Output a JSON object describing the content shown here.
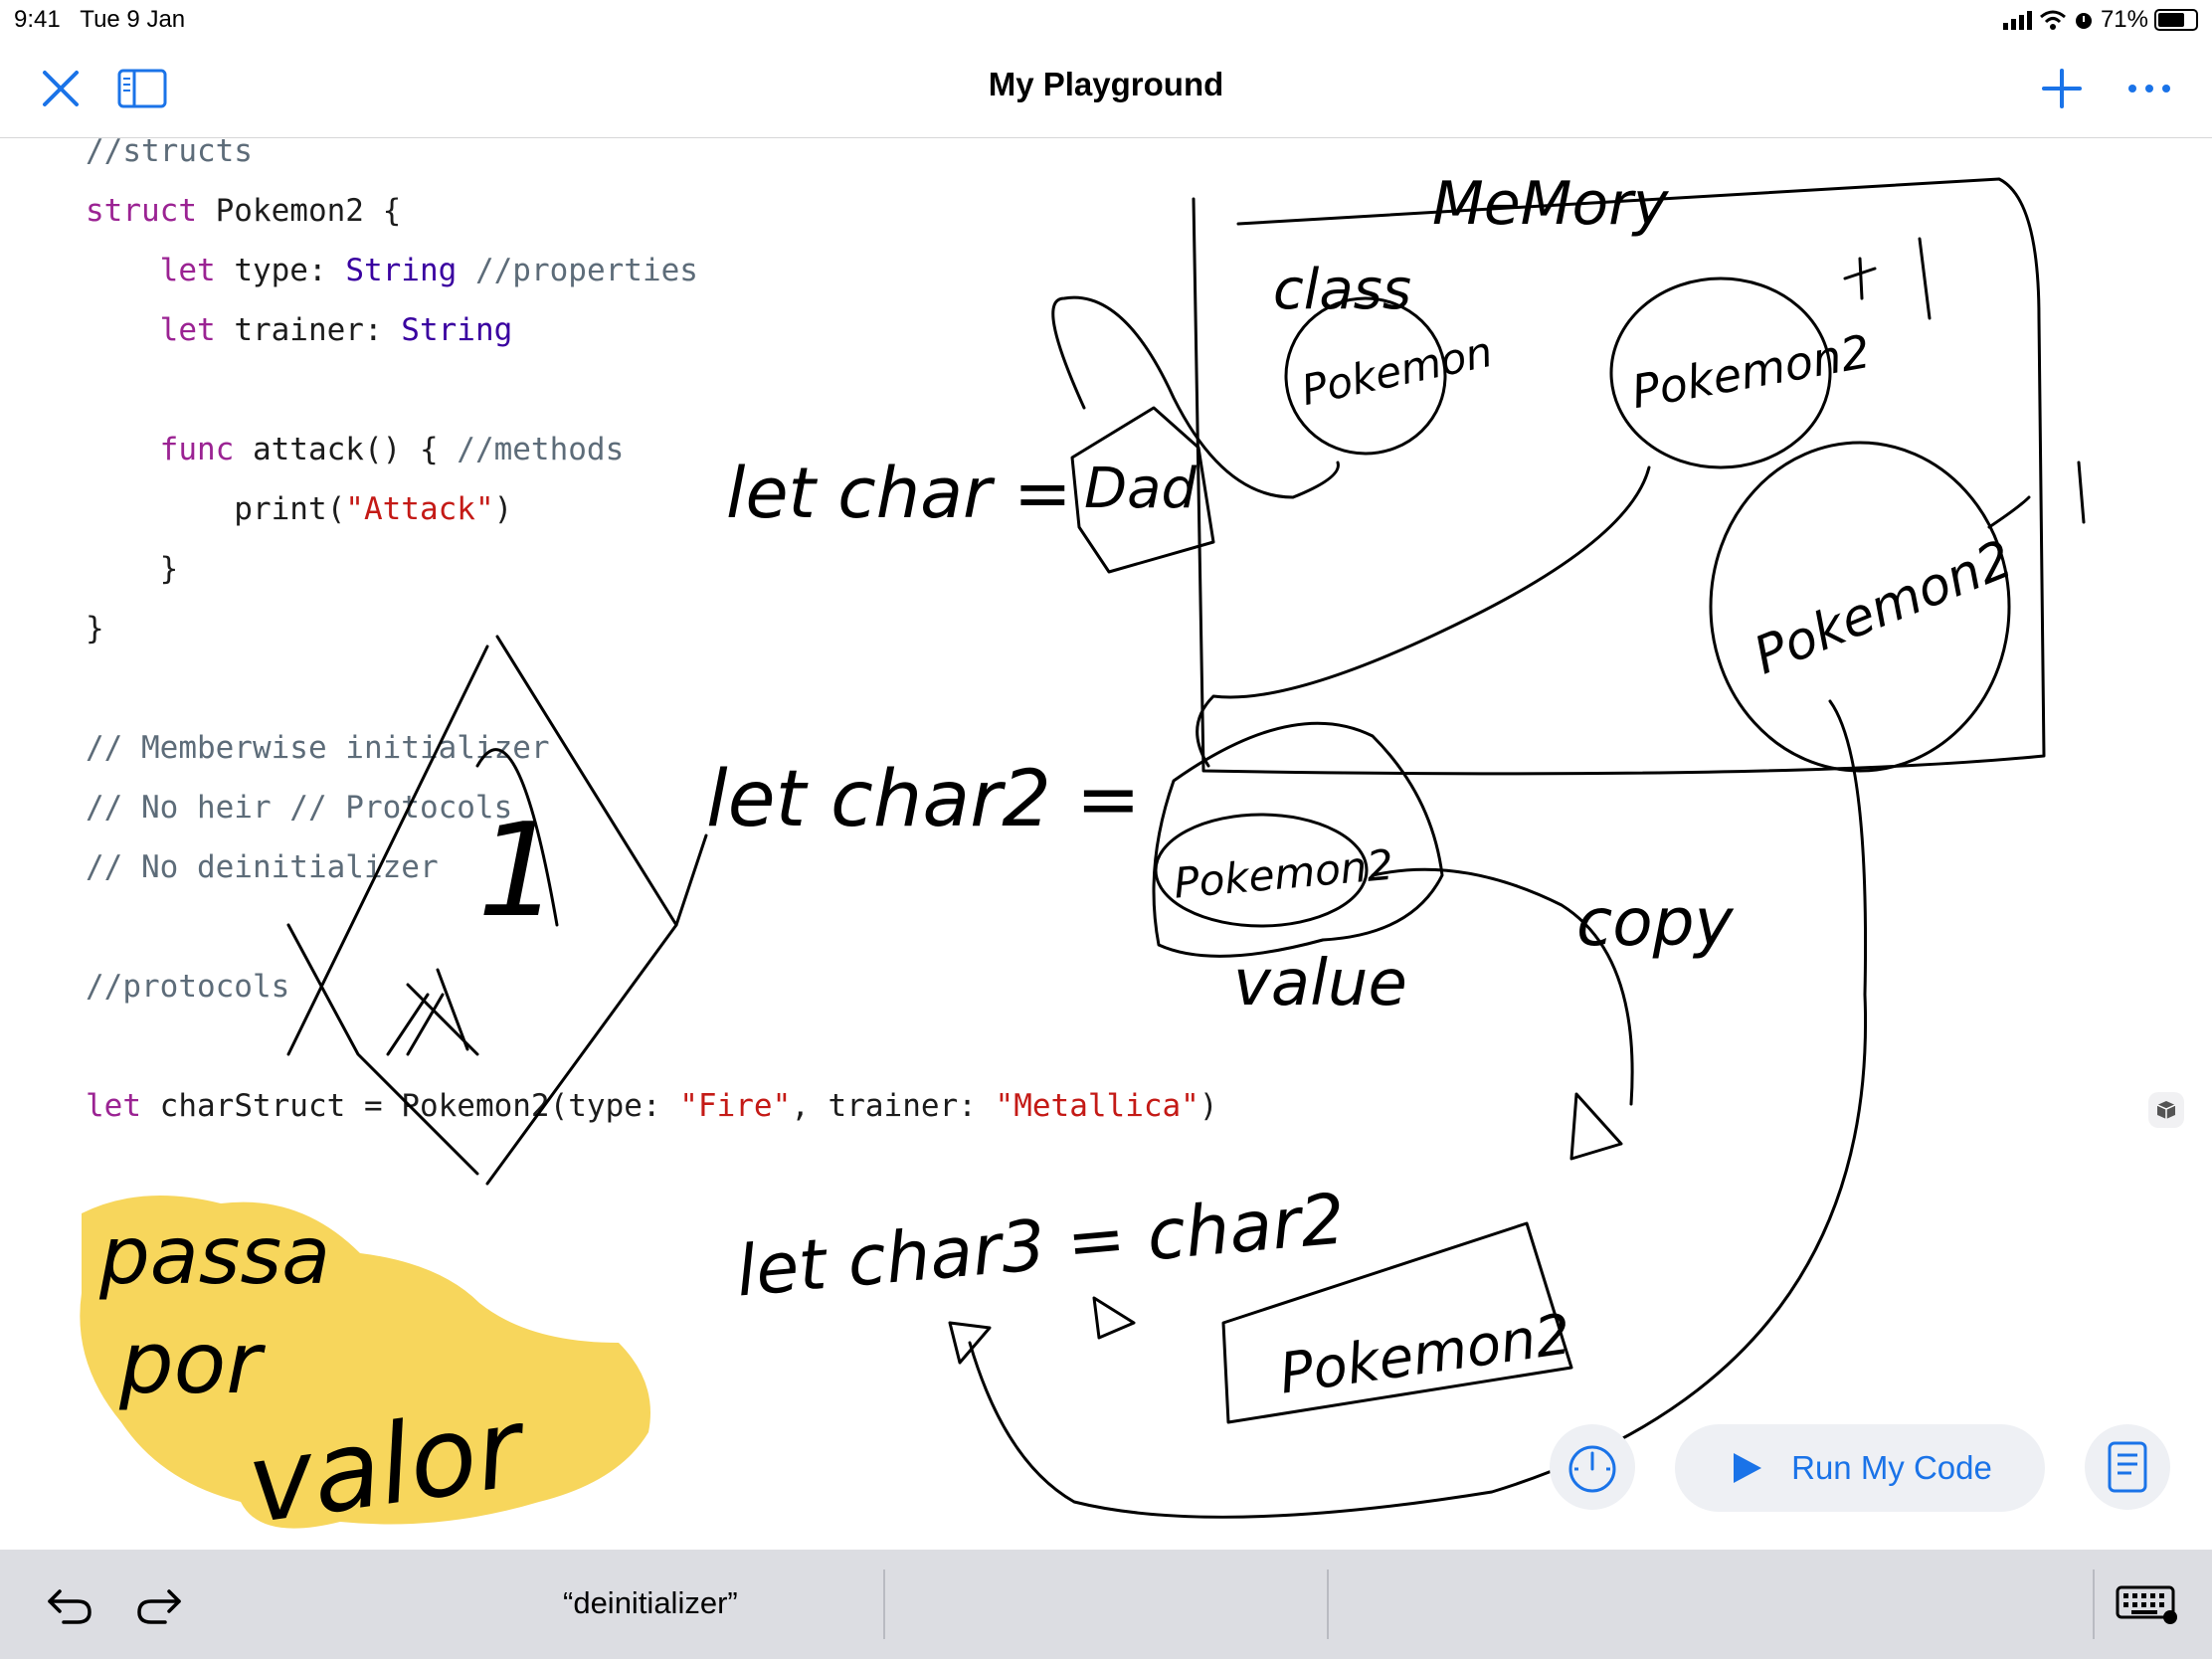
{
  "status_bar": {
    "time": "9:41",
    "date": "Tue 9 Jan",
    "battery": "71%"
  },
  "nav_bar": {
    "title": "My Playground",
    "close_icon": "close-icon",
    "sidebar_icon": "sidebar-icon",
    "add_icon": "plus-icon",
    "more_icon": "ellipsis-icon"
  },
  "code": {
    "lines": [
      "//structs",
      "struct Pokemon2 {",
      "    let type: String //properties",
      "    let trainer: String",
      "",
      "    func attack() { //methods",
      "        print(\"Attack\")",
      "    }",
      "}",
      "",
      "// Memberwise initializer",
      "// No heir // Protocols",
      "// No deinitializer",
      "",
      "//protocols",
      "",
      "let charStruct = Pokemon2(type: \"Fire\", trainer: \"Metallica\")"
    ]
  },
  "handwriting": {
    "memory": "MeMory",
    "class": "class",
    "pokemon_a": "Pokemon",
    "pokemon_b": "Pokemon2",
    "pokemon_c": "Pokemon2",
    "let_char": "let char =",
    "dad": "Dad",
    "let_char2": "let char2 =",
    "pokemon_value": "Pokemon2",
    "value": "value",
    "copy": "copy",
    "let_char3": "let char3 = char2",
    "pokemon_copy": "Pokemon2",
    "passa_por_valor": [
      "passa",
      "por",
      "valor"
    ],
    "number": "1"
  },
  "controls": {
    "run_label": "Run My Code"
  },
  "shortcut_bar": {
    "suggestion": "“deinitializer”"
  }
}
